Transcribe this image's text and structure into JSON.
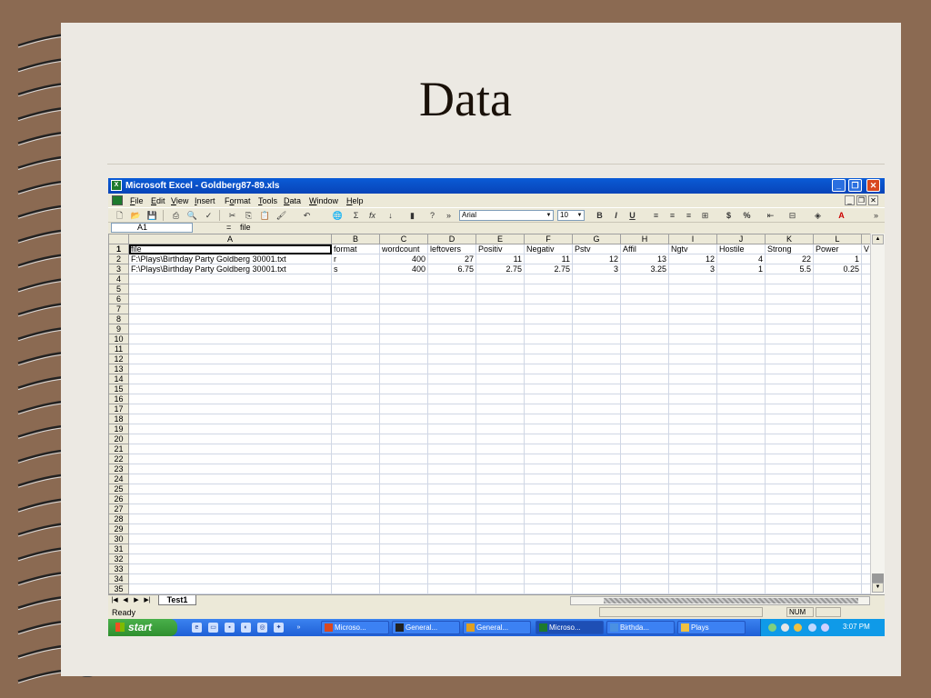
{
  "slide": {
    "title": "Data"
  },
  "window": {
    "title": "Microsoft Excel - Goldberg87-89.xls",
    "minimize_label": "_",
    "restore_label": "❐",
    "close_label": "✕"
  },
  "menu": {
    "items": [
      {
        "label": "File",
        "key": "F",
        "rest": "ile"
      },
      {
        "label": "Edit",
        "key": "E",
        "rest": "dit"
      },
      {
        "label": "View",
        "key": "V",
        "rest": "iew"
      },
      {
        "label": "Insert",
        "key": "I",
        "rest": "nsert"
      },
      {
        "label": "Format",
        "key": "o",
        "pre": "F",
        "rest": "rmat"
      },
      {
        "label": "Tools",
        "key": "T",
        "rest": "ools"
      },
      {
        "label": "Data",
        "key": "D",
        "rest": "ata"
      },
      {
        "label": "Window",
        "key": "W",
        "rest": "indow"
      },
      {
        "label": "Help",
        "key": "H",
        "rest": "elp"
      }
    ],
    "doc_min": "_",
    "doc_restore": "❐",
    "doc_close": "✕"
  },
  "toolbar": {
    "font_name": "Arial",
    "font_size": "10",
    "icons": [
      "new-icon",
      "open-icon",
      "save-icon",
      "print-icon",
      "print-preview-icon",
      "spelling-icon",
      "cut-icon",
      "copy-icon",
      "paste-icon",
      "format-painter-icon",
      "undo-icon",
      "hyperlink-icon",
      "autosum-icon",
      "function-icon",
      "sort-ascending-icon",
      "chart-wizard-icon",
      "help-icon"
    ],
    "bold": "B",
    "italic": "I",
    "underline": "U",
    "currency": "$",
    "percent": "%"
  },
  "formula_bar": {
    "cell_ref": "A1",
    "equals": "=",
    "value": "file"
  },
  "sheet": {
    "columns": [
      "A",
      "B",
      "C",
      "D",
      "E",
      "F",
      "G",
      "H",
      "I",
      "J",
      "K",
      "L"
    ],
    "header_row": [
      "file",
      "format",
      "wordcount",
      "leftovers",
      "Positiv",
      "Negativ",
      "Pstv",
      "Affil",
      "Ngtv",
      "Hostile",
      "Strong",
      "Power"
    ],
    "rows": [
      [
        "F:\\Plays\\Birthday Party Goldberg 30001.txt",
        "r",
        "400",
        "27",
        "11",
        "11",
        "12",
        "13",
        "12",
        "4",
        "22",
        "1"
      ],
      [
        "F:\\Plays\\Birthday Party Goldberg 30001.txt",
        "s",
        "400",
        "6.75",
        "2.75",
        "2.75",
        "3",
        "3.25",
        "3",
        "1",
        "5.5",
        "0.25"
      ]
    ],
    "overflow_col_fragment": "V",
    "row_count": 35
  },
  "tabs": {
    "sheet_name": "Test1"
  },
  "status": {
    "text": "Ready",
    "num": "NUM"
  },
  "taskbar": {
    "start_label": "start",
    "tasks": [
      {
        "label": "Microso...",
        "color": "#d9481f"
      },
      {
        "label": "General...",
        "color": "#222222"
      },
      {
        "label": "General...",
        "color": "#e0a020"
      },
      {
        "label": "Microso...",
        "color": "#1e7a2e"
      },
      {
        "label": "Birthda...",
        "color": "#4a90e2"
      },
      {
        "label": "Plays",
        "color": "#f0c040"
      }
    ],
    "clock": "3:07 PM"
  },
  "colors": {
    "slide_bg": "#ece9e3",
    "frame": "#8b6a52",
    "xp_blue": "#0a5bd6",
    "excel_green": "#1e7a2e"
  }
}
